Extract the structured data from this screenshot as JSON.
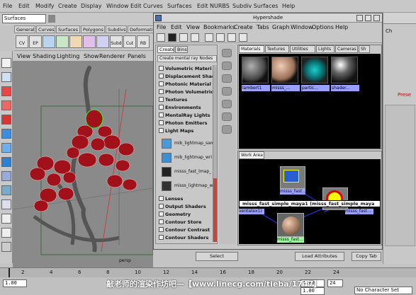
{
  "maya_menu": [
    "File",
    "Edit",
    "Modify",
    "Create",
    "Display",
    "Window",
    "Edit Curves",
    "Surfaces",
    "Edit NURBS",
    "Subdiv Surfaces",
    "Help"
  ],
  "mode_select": "Surfaces",
  "shelf_tabs": [
    "General",
    "Curves",
    "Surfaces",
    "Polygons",
    "Subdivs",
    "Deformation"
  ],
  "shelf_icons": [
    "CV",
    "EP",
    "",
    "",
    "",
    "",
    "",
    "Subd",
    "Cut",
    "RB",
    "",
    ""
  ],
  "panel_menu": [
    "View",
    "Shading",
    "Lighting",
    "Show",
    "Renderer",
    "Panels"
  ],
  "viewport": {
    "camera_label": "persp"
  },
  "right_panel": {
    "label1": "Ch",
    "label2": "Prese"
  },
  "timeline": {
    "ticks": [
      "2",
      "4",
      "6",
      "8",
      "10",
      "12",
      "14",
      "16",
      "18",
      "20",
      "22",
      "24"
    ],
    "start": "1.00",
    "end": "1.00",
    "current": "24",
    "anim_end": "1.00",
    "char_set": "No Character Set"
  },
  "hypershade": {
    "title": "Hypershade",
    "menus": [
      "File",
      "Edit",
      "View",
      "Bookmarks",
      "Create",
      "Tabs",
      "Graph",
      "Window",
      "Options",
      "Help"
    ],
    "left_tabs": [
      "Create",
      "Bins"
    ],
    "create_header": "Create mental ray Nodes",
    "tree": [
      "Volumetric Materi",
      "Displacement Shad",
      "Photonic Material",
      "Photon Volumetric",
      "Textures",
      "Environments",
      "MentalRay Lights",
      "Photon Emitters",
      "Light Maps"
    ],
    "nodes": [
      "mib_lightmap_sam",
      "mib_lightmap_wri",
      "misss_fast_lmap_",
      "misss_lightmap_w"
    ],
    "tree2": [
      "Lenses",
      "Output Shaders",
      "Geometry",
      "Contour Store",
      "Contour Contrast",
      "Contour Shaders"
    ],
    "material_tabs": [
      "Materials",
      "Textures",
      "Utilities",
      "Lights",
      "Cameras",
      "Sh"
    ],
    "swatches": [
      "lambert1",
      "misss_...",
      "partic...",
      "shader..."
    ],
    "work_tab": "Work Area",
    "work_nodes": {
      "title_bar": "misss_fast_simple_maya1 (misss_fast_simple_maya",
      "label_top": "misss_fast...",
      "label_left": "ventatex1)",
      "label_bottom": "misss_fast...",
      "label_right": "misss_fast..."
    },
    "bottom_buttons": [
      "Select",
      "Load Attributes",
      "Copy Tab"
    ]
  },
  "watermark": "敲老师的渲染作坊吧—【www.linecg.com/tieba/1747】"
}
